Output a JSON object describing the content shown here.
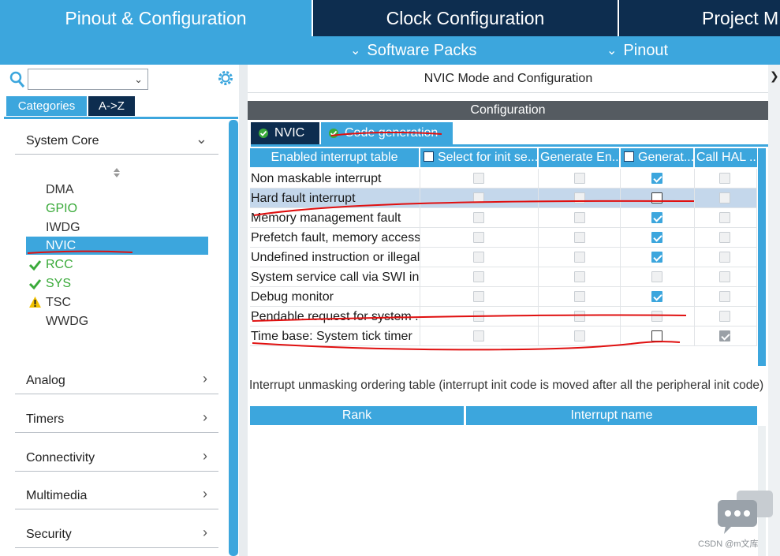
{
  "top_tabs": [
    {
      "label": "Pinout & Configuration",
      "active": true
    },
    {
      "label": "Clock Configuration",
      "active": false
    },
    {
      "label": "Project M",
      "active": false
    }
  ],
  "sub_tabs": [
    {
      "label": "Software Packs"
    },
    {
      "label": "Pinout"
    }
  ],
  "left": {
    "search": {
      "value": "",
      "placeholder": ""
    },
    "category_tabs": [
      {
        "label": "Categories",
        "active": true
      },
      {
        "label": "A->Z",
        "active": false
      }
    ],
    "sections": [
      {
        "label": "System Core",
        "expanded": true
      },
      {
        "label": "Analog",
        "expanded": false
      },
      {
        "label": "Timers",
        "expanded": false
      },
      {
        "label": "Connectivity",
        "expanded": false
      },
      {
        "label": "Multimedia",
        "expanded": false
      },
      {
        "label": "Security",
        "expanded": false
      }
    ],
    "system_core_items": [
      {
        "label": "DMA",
        "status": "none",
        "color": "#333333"
      },
      {
        "label": "GPIO",
        "status": "none",
        "color": "#3aaa3a"
      },
      {
        "label": "IWDG",
        "status": "none",
        "color": "#333333"
      },
      {
        "label": "NVIC",
        "status": "selected",
        "color": "#ffffff"
      },
      {
        "label": "RCC",
        "status": "check-icon",
        "color": "#3aaa3a"
      },
      {
        "label": "SYS",
        "status": "check-icon",
        "color": "#3aaa3a"
      },
      {
        "label": "TSC",
        "status": "warning-icon",
        "color": "#333333"
      },
      {
        "label": "WWDG",
        "status": "none",
        "color": "#333333"
      }
    ]
  },
  "main": {
    "mode_title": "NVIC Mode and Configuration",
    "config_header": "Configuration",
    "config_tabs": [
      {
        "label": "NVIC",
        "active": false
      },
      {
        "label": "Code generation",
        "active": true
      }
    ],
    "interrupt_table": {
      "columns": [
        "Enabled interrupt table",
        "Select for init se...",
        "Generate En...",
        "Generat...",
        "Call HAL ..."
      ],
      "rows": [
        {
          "name": "Non maskable interrupt",
          "select_init": "off",
          "generate_enable": "off",
          "generate_irq": "on",
          "call_hal": "off",
          "selected": false
        },
        {
          "name": "Hard fault interrupt",
          "select_init": "off",
          "generate_enable": "off",
          "generate_irq": "unchecked",
          "call_hal": "off",
          "selected": true
        },
        {
          "name": "Memory management fault",
          "select_init": "off",
          "generate_enable": "off",
          "generate_irq": "on",
          "call_hal": "off",
          "selected": false
        },
        {
          "name": "Prefetch fault, memory access...",
          "select_init": "off",
          "generate_enable": "off",
          "generate_irq": "on",
          "call_hal": "off",
          "selected": false
        },
        {
          "name": "Undefined instruction or illegal...",
          "select_init": "off",
          "generate_enable": "off",
          "generate_irq": "on",
          "call_hal": "off",
          "selected": false
        },
        {
          "name": "System service call via SWI in...",
          "select_init": "off",
          "generate_enable": "off",
          "generate_irq": "off",
          "call_hal": "off",
          "selected": false
        },
        {
          "name": "Debug monitor",
          "select_init": "off",
          "generate_enable": "off",
          "generate_irq": "on",
          "call_hal": "off",
          "selected": false
        },
        {
          "name": "Pendable request for system ...",
          "select_init": "off",
          "generate_enable": "off",
          "generate_irq": "off",
          "call_hal": "off",
          "selected": false
        },
        {
          "name": "Time base: System tick timer",
          "select_init": "off",
          "generate_enable": "off",
          "generate_irq": "unchecked",
          "call_hal": "gray-on",
          "selected": false
        }
      ]
    },
    "unmask_label": "Interrupt unmasking ordering table (interrupt init code is moved after all the peripheral init code)",
    "ordering_table": {
      "columns": [
        "Rank",
        "Interrupt name"
      ]
    }
  },
  "watermark": "CSDN @m文库",
  "colors": {
    "accent": "#3ca6dd",
    "navy": "#0d2d4f",
    "selected_row": "#c4d7eb",
    "annotation_red": "#e01010"
  }
}
